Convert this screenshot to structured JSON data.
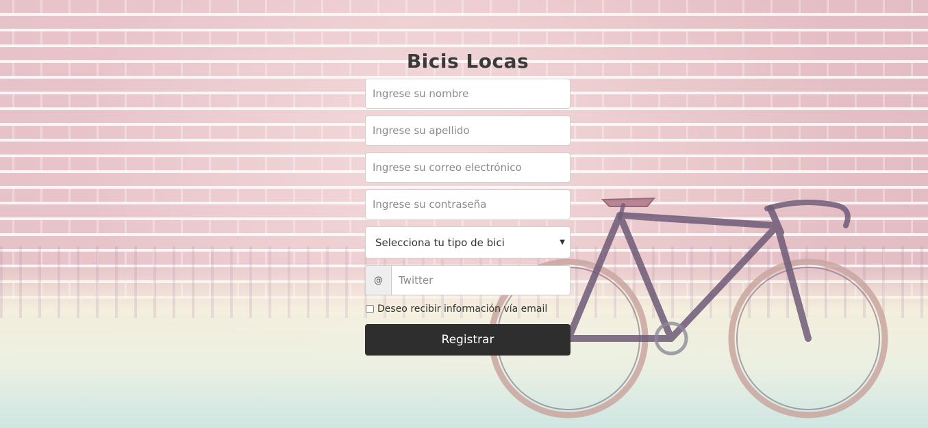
{
  "form": {
    "title": "Bicis Locas",
    "name_placeholder": "Ingrese su nombre",
    "lastname_placeholder": "Ingrese su apellido",
    "email_placeholder": "Ingrese su correo electrónico",
    "password_placeholder": "Ingrese su contraseña",
    "bike_select_value": "Selecciona tu tipo de bici",
    "twitter_addon": "@",
    "twitter_placeholder": "Twitter",
    "newsletter_label": "Deseo recibir información vía email",
    "submit_label": "Registrar"
  },
  "colors": {
    "button_bg": "#2e2e2e",
    "title": "#3a3a3a",
    "wall": "#e8c4ca",
    "bike_frame": "#6f5a78"
  }
}
